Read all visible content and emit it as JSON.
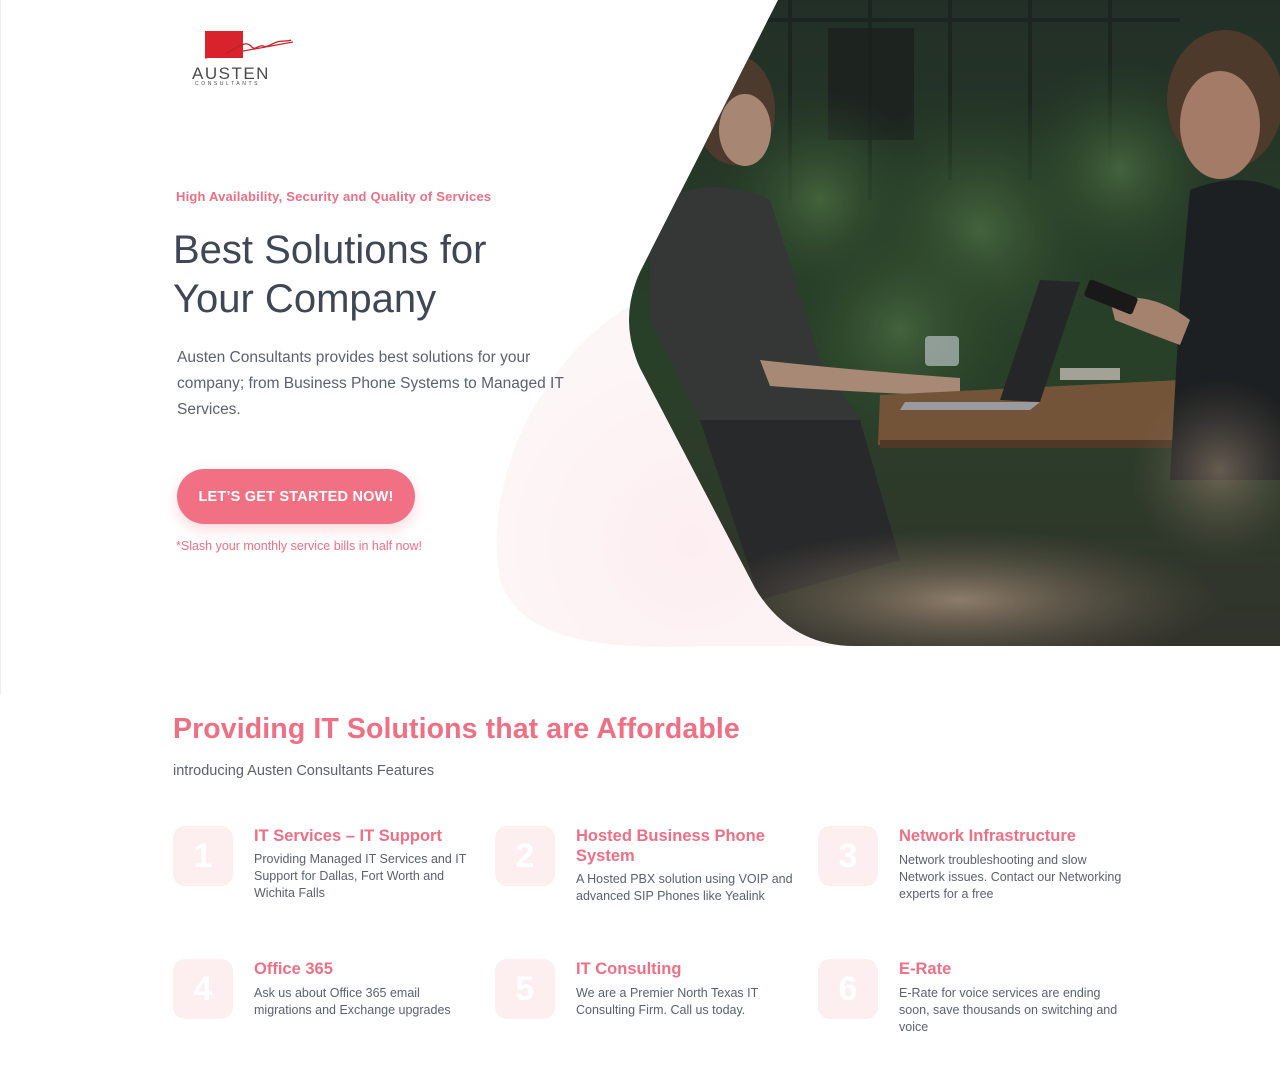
{
  "brand": {
    "name": "AUSTEN",
    "tagline": "CONSULTANTS",
    "accent_color": "#ef6f85",
    "logo_red": "#d8222c"
  },
  "hero": {
    "kicker": "High Availability, Security and Quality of Services",
    "title_line1": "Best Solutions for",
    "title_line2": "Your Company",
    "description": "Austen Consultants provides best solutions for your company; from Business Phone Systems to Managed IT Services.",
    "cta_label": "LET’S GET STARTED NOW!",
    "cta_note": "*Slash your monthly service bills in half now!",
    "image_subject": "business-meeting-photo"
  },
  "features": {
    "title": "Providing IT Solutions that are Affordable",
    "subtitle": "introducing Austen Consultants Features",
    "items": [
      {
        "number": "1",
        "title": "IT Services – IT Support",
        "description": "Providing Managed IT Services and IT Support for Dallas, Fort Worth and Wichita Falls"
      },
      {
        "number": "2",
        "title": "Hosted Business Phone System",
        "description": "A Hosted PBX solution using VOIP and advanced SIP Phones like Yealink"
      },
      {
        "number": "3",
        "title": "Network Infrastructure",
        "description": "Network troubleshooting and slow Network issues. Contact our Networking experts for a free"
      },
      {
        "number": "4",
        "title": "Office 365",
        "description": "Ask us about Office 365 email migrations and Exchange upgrades"
      },
      {
        "number": "5",
        "title": "IT Consulting",
        "description": "We are a Premier North Texas IT Consulting Firm. Call us today."
      },
      {
        "number": "6",
        "title": "E-Rate",
        "description": "E-Rate for voice services are ending soon, save thousands on switching and voice"
      }
    ]
  }
}
